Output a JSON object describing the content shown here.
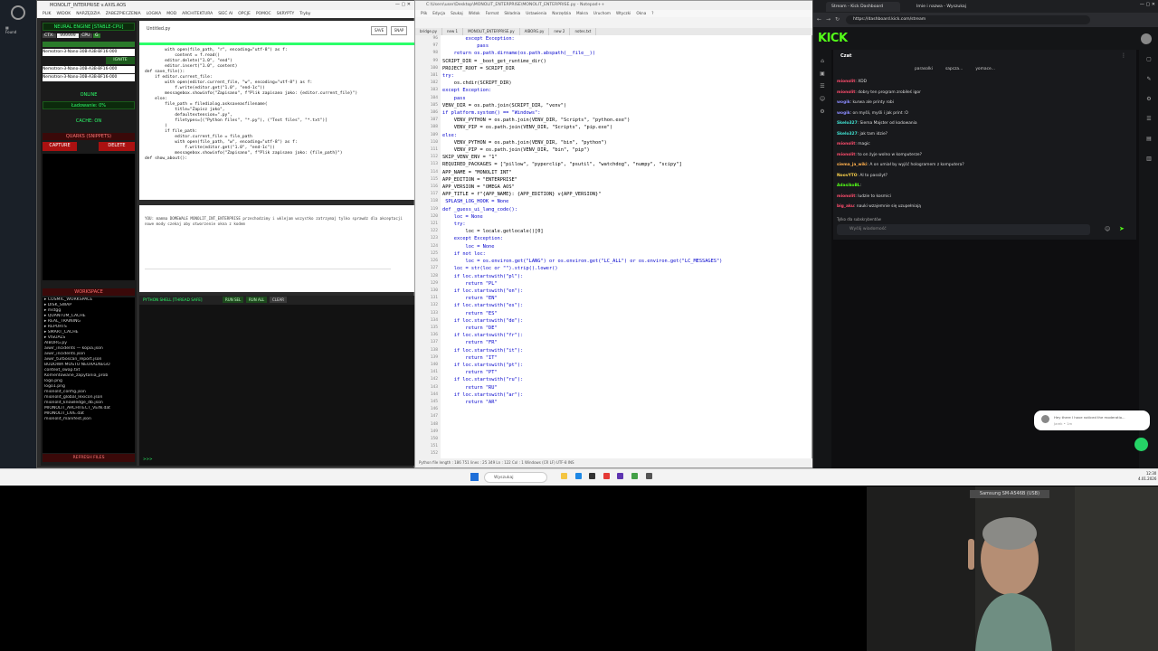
{
  "app": {
    "title": "MONOLIT_INTERPRISE v.AXIS.AOS",
    "menu": [
      "PLIK",
      "WIDOK",
      "NARZĘDZIA",
      "ZABEZPIECZENIA",
      "LOGIKA",
      "MOD",
      "ARCHITEKTURA",
      "SIEĆ AI",
      "OPCJE",
      "POMOC",
      "SKRYPTY",
      "Tryby"
    ],
    "engine_header": "NEURAL ENGINE [STABLE-CPU]",
    "ctx_label": "CTX:",
    "ctx_value": "999999",
    "cpu_label": "CPU",
    "model_selected": "Nemotron-3-Nano-30B-A3B-BF16-000",
    "model_option": "Nemotron-3-Nano-30B-A3B-BF16-000",
    "ignite_button": "IGNITE",
    "status_online": "ONLINE",
    "loading": "Ładowanie: 0%",
    "cache_on": "CACHE: ON",
    "quarks_header": "QUARKS (SNIPPETS)",
    "capture_button": "CAPTURE",
    "delete_button": "DELETE",
    "workspace_header": "WORKSPACE",
    "files": [
      "COSMIC_WORKSPACE",
      "DISK_SWAP",
      "mstgg",
      "QUANTUM_CACHE",
      "REAL_TRAINING",
      "REPORTS",
      "SMART_CACHE",
      "VISUALS",
      "AIBORG.py",
      "aiwir_incidents — kopia.json",
      "aiwir_incidents.json",
      "aiwir_turboscan_report.json",
      "BUDOWA MOSTU NEURALNEGO",
      "context_swap.txt",
      "Komentowane_zapytania_prob",
      "logo.png",
      "logo1.png",
      "mionolit_config.json",
      "mionolit_global_lexicon.json",
      "mionolit_knowledge_db.json",
      "MIONOLIT_ARCHITECT_VEIN.dat",
      "MIONOLIT_LIVE.dat",
      "mionolit_manifest.json"
    ],
    "refresh_button": "REFRESH FILES",
    "editor_tab": "Untitled.py",
    "save_button": "SAVE",
    "snap_button": "SNAP",
    "code_lines": [
      "        with open(file_path, \"r\", encoding=\"utf-8\") as f:",
      "            content = f.read()",
      "        editor.delete(\"1.0\", \"end\")",
      "        editor.insert(\"1.0\", content)",
      "",
      "def save_file():",
      "    if editor.current_file:",
      "        with open(editor.current_file, \"w\", encoding=\"utf-8\") as f:",
      "            f.write(editor.get(\"1.0\", \"end-1c\"))",
      "        messagebox.showinfo(\"Zapisano\", f\"Plik zapisano jako: {editor.current_file}\")",
      "    else:",
      "        file_path = filedialog.asksaveasfilename(",
      "            title=\"Zapisz jako\",",
      "            defaultextension=\".py\",",
      "            filetypes=[(\"Python files\", \"*.py\"), (\"Text files\", \"*.txt\")]",
      "        )",
      "        if file_path:",
      "            editor.current_file = file_path",
      "            with open(file_path, \"w\", encoding=\"utf-8\") as f:",
      "                f.write(editor.get(\"1.0\", \"end-1c\"))",
      "            messagebox.showinfo(\"Zapisano\", f\"Plik zapisano jako: {file_path}\")",
      "",
      "def show_about():"
    ],
    "console_text": "YOU: mamma DOMEWALE MONOLIT_INT_ENTERPRISE przechodzimy i wklejam wszystko zatrzymaj tylko sprawdz dla akceptacji nowe mody czekaj aby otworzenie okna z kodem",
    "shell_title": "PYTHON SHELL [THREAD SAFE]",
    "run_sel": "RUN SEL",
    "run_all": "RUN ALL",
    "clear": "CLEAR",
    "prompt": ">>>"
  },
  "notepad": {
    "title": "C:\\Users\\user\\Desktop\\MONOLIT_ENTERPRISE\\MONOLIT_ENTERPRISE.py - Notepad++",
    "menu": [
      "Plik",
      "Edycja",
      "Szukaj",
      "Widok",
      "Format",
      "Składnia",
      "Ustawienia",
      "Narzędzia",
      "Makra",
      "Uruchom",
      "Wtyczki",
      "Okna",
      "?"
    ],
    "tabs": [
      "bridge.py",
      "new 1",
      "MONOLIT_ENTERPRISE.py",
      "AIBORG.py",
      "new 2",
      "notes.txt"
    ],
    "line_numbers": [
      "96",
      "97",
      "98",
      "99",
      "100",
      "101",
      "102",
      "103",
      "104",
      "105",
      "106",
      "107",
      "108",
      "109",
      "110",
      "111",
      "112",
      "113",
      "114",
      "115",
      "116",
      "117",
      "118",
      "119",
      "120",
      "121",
      "122",
      "123",
      "124",
      "125",
      "126",
      "127",
      "128",
      "129",
      "130",
      "131",
      "132",
      "133",
      "134",
      "135",
      "136",
      "137",
      "138",
      "139",
      "140",
      "141",
      "142",
      "143",
      "144",
      "145",
      "146",
      "147",
      "148",
      "149",
      "150",
      "151",
      "152",
      "153",
      "154",
      "155"
    ],
    "lines": [
      "        except Exception:",
      "            pass",
      "    return os.path.dirname(os.path.abspath(__file__))",
      "",
      "SCRIPT_DIR = _boot_get_runtime_dir()",
      "PROJECT_ROOT = SCRIPT_DIR",
      "try:",
      "    os.chdir(SCRIPT_DIR)",
      "except Exception:",
      "    pass",
      "VENV_DIR = os.path.join(SCRIPT_DIR, \"venv\")",
      "if platform.system() == \"Windows\":",
      "    VENV_PYTHON = os.path.join(VENV_DIR, \"Scripts\", \"python.exe\")",
      "    VENV_PIP = os.path.join(VENV_DIR, \"Scripts\", \"pip.exe\")",
      "else:",
      "    VENV_PYTHON = os.path.join(VENV_DIR, \"bin\", \"python\")",
      "    VENV_PIP = os.path.join(VENV_DIR, \"bin\", \"pip\")",
      "",
      "SKIP_VENV_ENV = \"1\"",
      "",
      "REQUIRED_PACKAGES = [\"pillow\", \"pyperclip\", \"psutil\", \"watchdog\", \"numpy\", \"scipy\"]",
      "",
      "",
      "APP_NAME = \"MONOLIT INT\"",
      "APP_EDITION = \"ENTERPRISE\"",
      "APP_VERSION = \"OMEGA AOS\"",
      "APP_TITLE = f\"{APP_NAME}: {APP_EDITION} v{APP_VERSION}\"",
      "",
      " SPLASH_LOG_HOOK = None",
      "",
      "def _guess_ui_lang_code():",
      "    loc = None",
      "    try:",
      "        loc = locale.getlocale()[0]",
      "    except Exception:",
      "        loc = None",
      "    if not loc:",
      "        loc = os.environ.get(\"LANG\") or os.environ.get(\"LC_ALL\") or os.environ.get(\"LC_MESSAGES\")",
      "    loc = str(loc or \"\").strip().lower()",
      "    if loc.startswith(\"pl\"):",
      "        return \"PL\"",
      "    if loc.startswith(\"en\"):",
      "        return \"EN\"",
      "    if loc.startswith(\"es\"):",
      "        return \"ES\"",
      "    if loc.startswith(\"de\"):",
      "        return \"DE\"",
      "    if loc.startswith(\"fr\"):",
      "        return \"FR\"",
      "    if loc.startswith(\"it\"):",
      "        return \"IT\"",
      "    if loc.startswith(\"pt\"):",
      "        return \"PT\"",
      "    if loc.startswith(\"ru\"):",
      "        return \"RU\"",
      "    if loc.startswith(\"ar\"):",
      "        return \"AR\""
    ],
    "status": "Python file   length : 186 751   lines : 25 349   Ln : 122   Col : 1   Windows (CR LF)   UTF-8   INS"
  },
  "browser": {
    "tabs": [
      "Stream - Kick Dashboard",
      "Imie i nazwa - Wyszukaj"
    ],
    "url": "https://dashboard.kick.com/stream",
    "logo": "KICK",
    "chat_title": "Czat",
    "pinned": [
      "parasolki",
      "sapcza...",
      "yomace..."
    ],
    "messages": [
      {
        "user": "mionolit",
        "text": "XDD",
        "color": "#ff4d6d"
      },
      {
        "user": "mionolit",
        "text": "dobry ten program zrobiłeś igor",
        "color": "#ff4d6d"
      },
      {
        "user": "wogik",
        "text": "kurwa ale printy robi",
        "color": "#8c8cff"
      },
      {
        "user": "wogik",
        "text": "on myśli, myśli i jak print :O",
        "color": "#8c8cff"
      },
      {
        "user": "Skelo327",
        "text": "Siema Majster od kodowania",
        "color": "#40e0d0"
      },
      {
        "user": "Skelo327",
        "text": "jak tam idzie?",
        "color": "#40e0d0"
      },
      {
        "user": "mionolit",
        "text": "magic",
        "color": "#ff4d6d"
      },
      {
        "user": "mionolit",
        "text": "to on żyje wolno w komputerze?",
        "color": "#ff4d6d"
      },
      {
        "user": "siema_ja_wiki",
        "text": "A on umiał by wyjść hologramem z komputera?",
        "color": "#ffb04d"
      },
      {
        "user": "NoovYTO",
        "text": "AI to passilyt?",
        "color": "#ffd54d"
      },
      {
        "user": "AdasikoBL",
        "text": "",
        "color": "#53fc18"
      },
      {
        "user": "mionolit",
        "text": "ludzie to kosmici",
        "color": "#ff4d6d"
      },
      {
        "user": "big_aku",
        "text": "nauki wzajemnie się uzupełniają",
        "color": "#ff4d6d"
      }
    ],
    "subscribers_only": "Tylko dla subskrybentów",
    "chat_placeholder": "Wyślij wiadomość",
    "toast": "Hey there I have noticed the moderatio...",
    "toast_sub": "Jarek • 1m"
  },
  "taskbar": {
    "search": "Wyszukaj",
    "time": "12:30",
    "date": "4.01.2026"
  },
  "webcam": {
    "label": "Samsung SM-A546B (USB)"
  }
}
